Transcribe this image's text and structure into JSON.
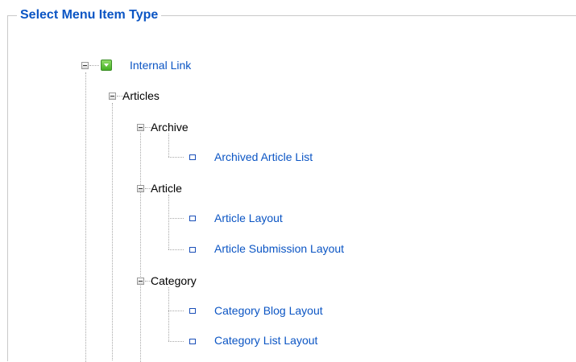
{
  "panel": {
    "legend": "Select Menu Item Type"
  },
  "tree": {
    "internal_link": "Internal Link",
    "articles": {
      "label": "Articles",
      "archive": {
        "label": "Archive",
        "items": [
          "Archived Article List"
        ]
      },
      "article": {
        "label": "Article",
        "items": [
          "Article Layout",
          "Article Submission Layout"
        ]
      },
      "category": {
        "label": "Category",
        "items": [
          "Category Blog Layout",
          "Category List Layout"
        ]
      }
    }
  },
  "colors": {
    "link": "#0b55c4",
    "legend": "#0b55c4",
    "icon_green": "#45b023"
  },
  "icons": {
    "toggle": "minus-box-icon",
    "internal_link": "green-folder-icon",
    "leaf": "square-bullet-icon"
  }
}
